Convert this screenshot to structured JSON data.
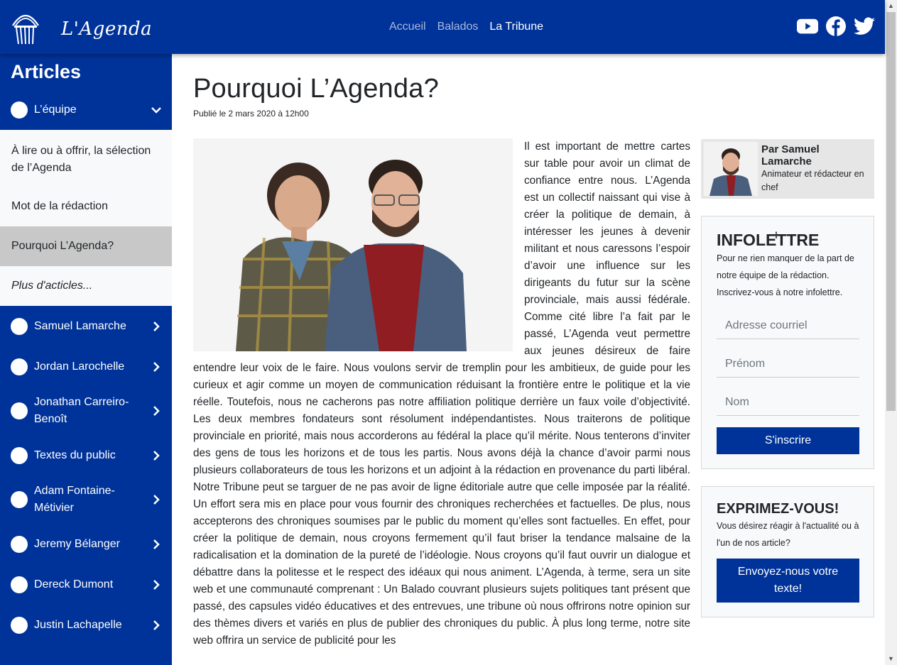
{
  "header": {
    "logo_text": "L'Agenda",
    "nav": [
      "Accueil",
      "Balados",
      "La Tribune"
    ],
    "social": [
      "youtube-icon",
      "facebook-icon",
      "twitter-icon"
    ]
  },
  "sidebar": {
    "title": "Articles",
    "open_section": "L’équipe",
    "sub_items": [
      "À lire ou à offrir, la sélection de l’Agenda",
      "Mot de la rédaction",
      "Pourquoi L’Agenda?",
      "Plus d'acticles..."
    ],
    "items": [
      "Samuel Lamarche",
      "Jordan Larochelle",
      "Jonathan Carreiro-Benoît",
      "Textes du public",
      "Adam Fontaine-Métivier",
      "Jeremy Bélanger",
      "Dereck Dumont",
      "Justin Lachapelle"
    ]
  },
  "article": {
    "title": "Pourquoi L’Agenda?",
    "date": "Publié le 2 mars 2020 à 12h00",
    "body": "Il est important de mettre cartes sur table pour avoir un climat de confiance entre nous. L’Agenda est un collectif naissant qui vise à créer la politique de demain, à intéresser les jeunes à devenir militant et nous caressons l’espoir d’avoir une influence sur les dirigeants du futur sur la scène provinciale, mais aussi fédérale. Comme cité libre l’a fait par le passé, L’Agenda veut permettre aux jeunes désireux de faire entendre leur voix de le faire. Nous voulons servir de tremplin pour les ambitieux, de guide pour les curieux et agir comme un moyen de communication réduisant la frontière entre le politique et la vie réelle. Toutefois, nous ne cacherons pas notre affiliation politique derrière un faux voile d’objectivité. Les deux membres fondateurs sont résolument indépendantistes. Nous traiterons de politique provinciale en priorité, mais nous accorderons au fédéral la place qu’il mérite. Nous tenterons d’inviter des gens de tous les horizons et de tous les partis. Nous avons déjà la chance d’avoir parmi nous plusieurs collaborateurs de tous les horizons et un adjoint à la rédaction en provenance du parti libéral. Notre Tribune peut se targuer de ne pas avoir de ligne éditoriale autre que celle imposée par la réalité. Un effort sera mis en place pour vous fournir des chroniques recherchées et factuelles. De plus, nous accepterons des chroniques soumises par le public du moment qu’elles sont factuelles. En effet, pour créer la politique de demain, nous croyons fermement qu’il faut briser la tendance malsaine de la radicalisation et la domination de la pureté de l’idéologie. Nous croyons qu’il faut ouvrir un dialogue et débattre dans la politesse et le respect des idéaux qui nous animent. L’Agenda, à terme, sera un site web et une communauté comprenant : Un Balado couvrant plusieurs sujets politiques tant présent que passé, des capsules vidéo éducatives et des entrevues, une tribune où nous offrirons notre opinion sur des thèmes divers et variés en plus de publier des chroniques du public. À plus long terme, notre site web offrira un service de publicité pour les"
  },
  "author": {
    "name": "Par Samuel Lamarche",
    "role": "Animateur et rédacteur en chef"
  },
  "newsletter": {
    "title": "INFOLETTRE",
    "text": "Pour ne rien manquer de la part de notre équipe de la rédaction. Inscrivez-vous à notre infolettre.",
    "email_placeholder": "Adresse courriel",
    "firstname_placeholder": "Prénom",
    "lastname_placeholder": "Nom",
    "button": "S'inscrire"
  },
  "express": {
    "title": "EXPRIMEZ-VOUS!",
    "text": "Vous désirez réagir à l'actualité ou à l'un de nos article?",
    "button": "Envoyez-nous votre texte!"
  },
  "colors": {
    "brand": "#003399",
    "sidebar_active": "#c8c8c8"
  }
}
